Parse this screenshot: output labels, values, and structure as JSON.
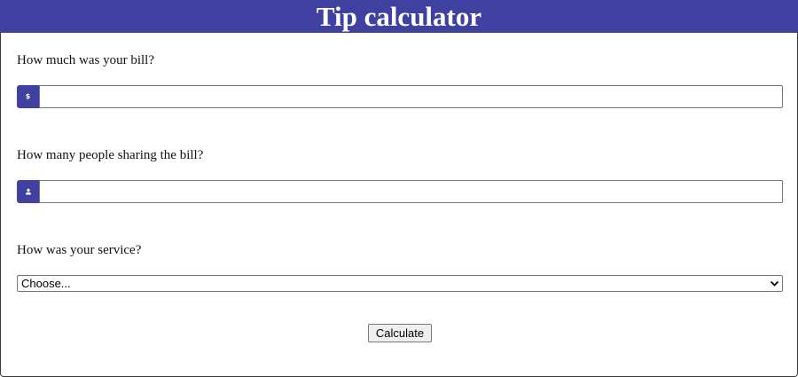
{
  "app": {
    "title": "Tip calculator"
  },
  "colors": {
    "accent": "#3f40a0",
    "header_text": "#ffffff",
    "border": "#767676"
  },
  "bill": {
    "label": "How much was your bill?",
    "addon_text": "$",
    "value": "",
    "placeholder": ""
  },
  "people": {
    "label": "How many people sharing the bill?",
    "addon_icon": "person-icon",
    "value": "",
    "placeholder": ""
  },
  "service": {
    "label": "How was your service?",
    "selected": "Choose...",
    "dropdown_icon": "chevron-down-icon"
  },
  "actions": {
    "calculate_label": "Calculate"
  }
}
